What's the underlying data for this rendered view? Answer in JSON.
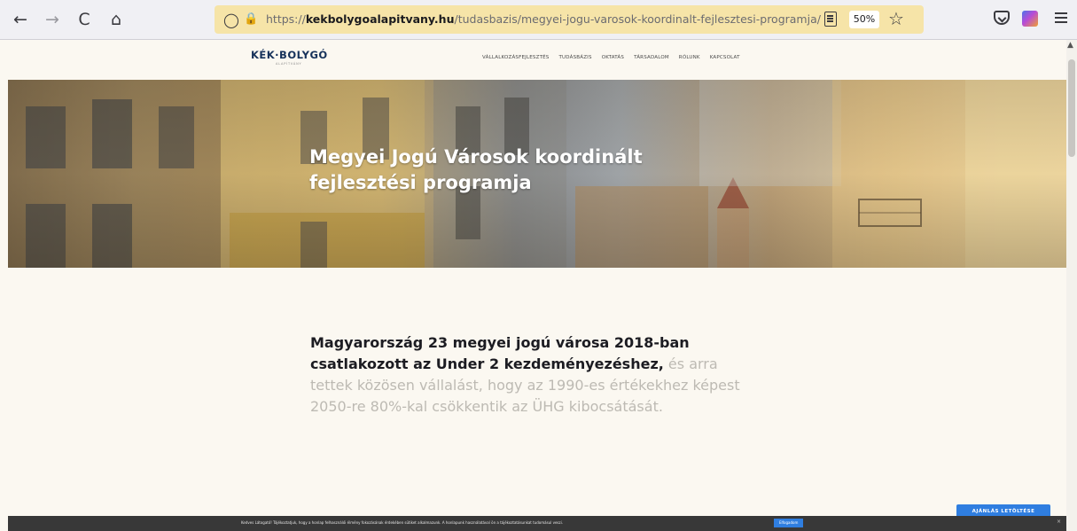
{
  "browser": {
    "url_prefix": "https://",
    "url_domain": "kekbolygoalapitvany.hu",
    "url_path": "/tudasbazis/megyei-jogu-varosok-koordinalt-fejlesztesi-programja/",
    "zoom": "50%",
    "icons": {
      "back": "←",
      "forward": "→",
      "reload": "C",
      "home": "⌂",
      "shield": "◯",
      "lock": "🔒",
      "bookmark_star": "☆"
    }
  },
  "site": {
    "logo": "KÉK·BOLYGÓ",
    "logo_sub": "ALAPÍTVÁNY",
    "nav": [
      "VÁLLALKOZÁSFEJLESZTÉS",
      "TUDÁSBÁZIS",
      "OKTATÁS",
      "TÁRSADALOM",
      "RÓLUNK",
      "KAPCSOLAT"
    ]
  },
  "hero": {
    "title": "Megyei Jogú Városok koordinált fejlesztési programja"
  },
  "intro": {
    "strong": "Magyarország 23 megyei jogú városa 2018-ban csatlakozott az Under 2 kezdeményezéshez,",
    "rest": " és arra tettek közösen vállalást, hogy az 1990-es értékekhez képest 2050-re 80%-kal csökkentik az ÜHG kibocsátását."
  },
  "cookie": {
    "text": "Kedves Látogató! Tájékoztatjuk, hogy a honlap felhasználói élmény fokozásának érdekében sütiket alkalmazunk. A honlapunk használatával ön a tájékoztatásunkat tudomásul veszi.",
    "accept": "Elfogadom",
    "close": "×"
  },
  "offer_button": "AJÁNLÁS LETÖLTÉSE",
  "colors": {
    "accent": "#2f7ee0",
    "page_bg": "#fbf8f1",
    "urlbar": "#f6e4a8"
  }
}
